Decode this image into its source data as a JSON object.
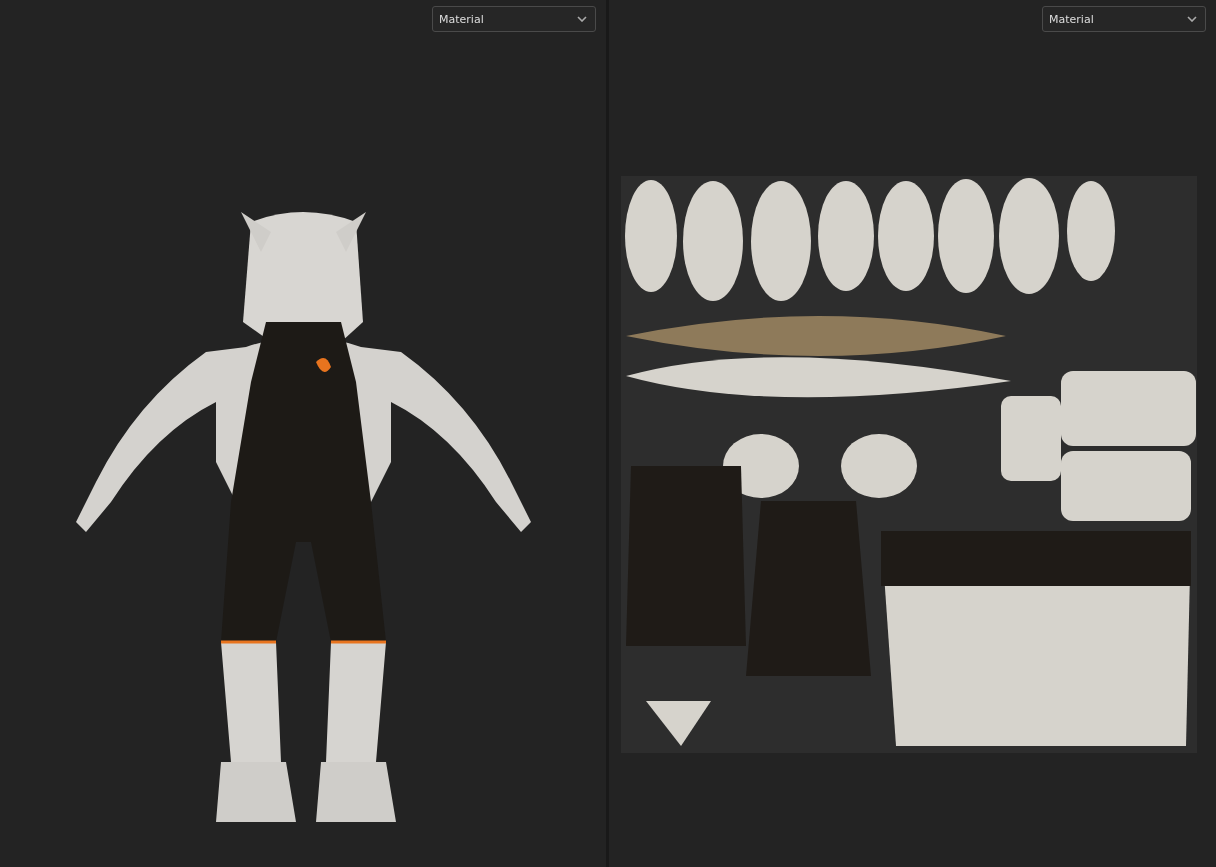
{
  "viewports": [
    {
      "kind": "model",
      "mode_dropdown": {
        "value": "Material"
      }
    },
    {
      "kind": "uv",
      "mode_dropdown": {
        "value": "Material"
      }
    }
  ]
}
